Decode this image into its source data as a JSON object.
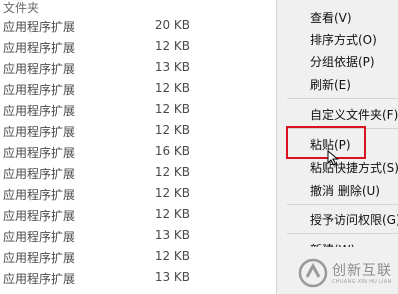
{
  "file_list": {
    "header_name": "文件夹",
    "rows": [
      {
        "name": "应用程序扩展",
        "size": "20 KB"
      },
      {
        "name": "应用程序扩展",
        "size": "12 KB"
      },
      {
        "name": "应用程序扩展",
        "size": "13 KB"
      },
      {
        "name": "应用程序扩展",
        "size": "12 KB"
      },
      {
        "name": "应用程序扩展",
        "size": "12 KB"
      },
      {
        "name": "应用程序扩展",
        "size": "12 KB"
      },
      {
        "name": "应用程序扩展",
        "size": "16 KB"
      },
      {
        "name": "应用程序扩展",
        "size": "12 KB"
      },
      {
        "name": "应用程序扩展",
        "size": "12 KB"
      },
      {
        "name": "应用程序扩展",
        "size": "12 KB"
      },
      {
        "name": "应用程序扩展",
        "size": "13 KB"
      },
      {
        "name": "应用程序扩展",
        "size": "12 KB"
      },
      {
        "name": "应用程序扩展",
        "size": "13 KB"
      }
    ]
  },
  "context_menu": {
    "items": [
      {
        "label": "查看(V)"
      },
      {
        "label": "排序方式(O)"
      },
      {
        "label": "分组依据(P)"
      },
      {
        "label": "刷新(E)"
      },
      {
        "label": "自定义文件夹(F)..."
      },
      {
        "label": "粘贴(P)"
      },
      {
        "label": "粘贴快捷方式(S)"
      },
      {
        "label": "撤消 删除(U)"
      },
      {
        "label": "授予访问权限(G)"
      },
      {
        "label": "新建(W)"
      }
    ]
  },
  "watermark": {
    "brand": "创新互联",
    "sub": "CHUANG XIN HU LIAN"
  },
  "colors": {
    "highlight": "#d7141f",
    "menu_bg": "#f0f0f0"
  },
  "icons": {
    "cursor": "arrow-cursor-icon",
    "logo": "brand-logo-icon"
  }
}
